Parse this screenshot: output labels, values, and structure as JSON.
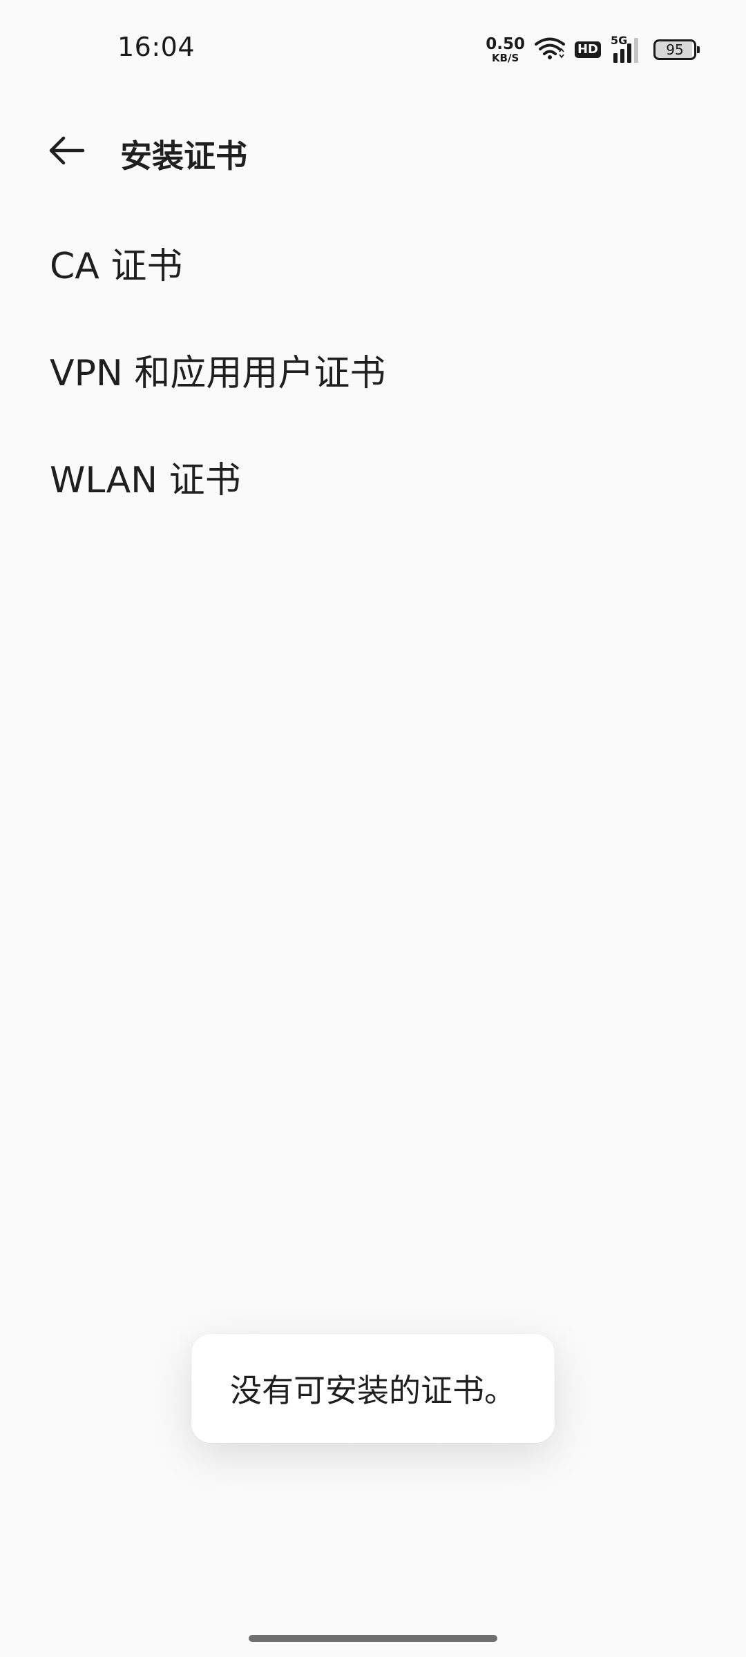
{
  "status_bar": {
    "time": "16:04",
    "net_speed_value": "0.50",
    "net_speed_unit": "KB/S",
    "hd_label": "HD",
    "network_type": "5G",
    "battery_level": "95",
    "icons": [
      "wifi-icon",
      "hd-icon",
      "cellular-signal-icon",
      "battery-icon"
    ]
  },
  "app_bar": {
    "title": "安装证书",
    "back_icon": "arrow-left-icon"
  },
  "list": {
    "items": [
      {
        "label": "CA 证书"
      },
      {
        "label": "VPN 和应用用户证书"
      },
      {
        "label": "WLAN 证书"
      }
    ]
  },
  "toast": {
    "message": "没有可安装的证书。"
  },
  "colors": {
    "background": "#fafafa",
    "text": "#1f1f1f",
    "toast_background": "#ffffff"
  }
}
